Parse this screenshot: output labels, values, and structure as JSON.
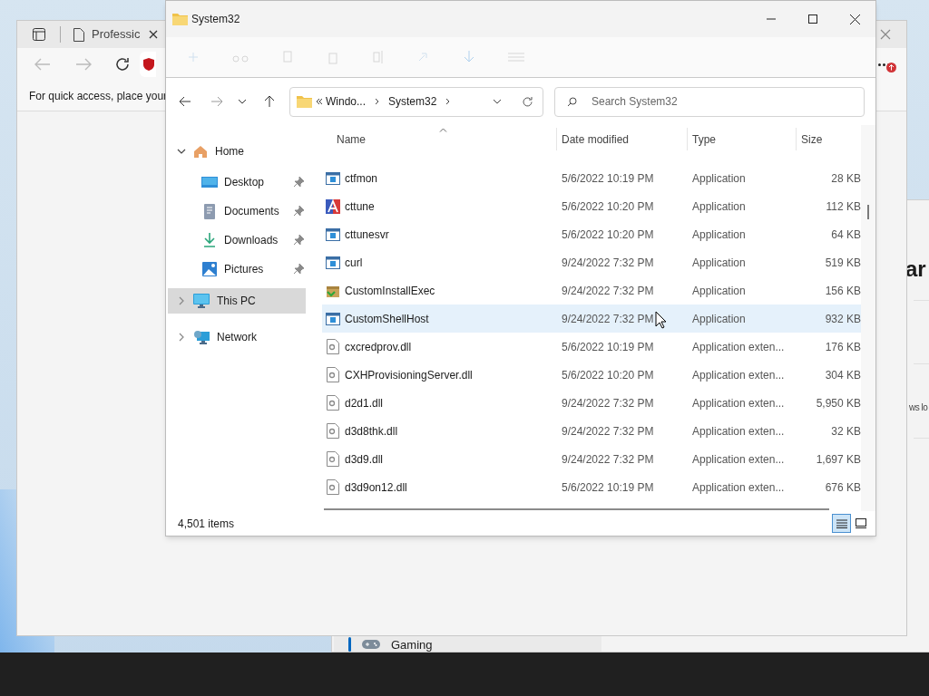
{
  "browser": {
    "tab": {
      "title": "Professic"
    },
    "favorites_hint": "For quick access, place your"
  },
  "settings_window": {
    "heading_fragment": "ar",
    "text_fragment": "ws lo",
    "nav_item": {
      "label": "Gaming",
      "selected": true
    }
  },
  "explorer": {
    "title": "System32",
    "breadcrumb": [
      "Windo...",
      "System32"
    ],
    "search_placeholder": "Search System32",
    "sidebar": [
      {
        "label": "Home",
        "kind": "home",
        "expanded": true,
        "selected": false,
        "children": [
          {
            "label": "Desktop",
            "kind": "desktop",
            "pinned": true,
            "selected": false
          },
          {
            "label": "Documents",
            "kind": "documents",
            "pinned": true,
            "selected": false
          },
          {
            "label": "Downloads",
            "kind": "downloads",
            "pinned": true,
            "selected": false
          },
          {
            "label": "Pictures",
            "kind": "pictures",
            "pinned": true,
            "selected": false
          }
        ]
      },
      {
        "label": "This PC",
        "kind": "computer",
        "expanded": false,
        "selected": true
      },
      {
        "label": "Network",
        "kind": "network",
        "expanded": false,
        "selected": false
      }
    ],
    "columns": [
      "Name",
      "Date modified",
      "Type",
      "Size"
    ],
    "rows": [
      {
        "name": "ctfmon",
        "date": "5/6/2022 10:19 PM",
        "type": "Application",
        "size": "28 KB",
        "kind": "program",
        "selected": false
      },
      {
        "name": "cttune",
        "date": "5/6/2022 10:20 PM",
        "type": "Application",
        "size": "112 KB",
        "kind": "lettered",
        "selected": false
      },
      {
        "name": "cttunesvr",
        "date": "5/6/2022 10:20 PM",
        "type": "Application",
        "size": "64 KB",
        "kind": "program",
        "selected": false
      },
      {
        "name": "curl",
        "date": "9/24/2022 7:32 PM",
        "type": "Application",
        "size": "519 KB",
        "kind": "program",
        "selected": false
      },
      {
        "name": "CustomInstallExec",
        "date": "9/24/2022 7:32 PM",
        "type": "Application",
        "size": "156 KB",
        "kind": "package",
        "selected": false
      },
      {
        "name": "CustomShellHost",
        "date": "9/24/2022 7:32 PM",
        "type": "Application",
        "size": "932 KB",
        "kind": "program",
        "selected": true
      },
      {
        "name": "cxcredprov.dll",
        "date": "5/6/2022 10:19 PM",
        "type": "Application exten...",
        "size": "176 KB",
        "kind": "library",
        "selected": false
      },
      {
        "name": "CXHProvisioningServer.dll",
        "date": "5/6/2022 10:20 PM",
        "type": "Application exten...",
        "size": "304 KB",
        "kind": "library",
        "selected": false
      },
      {
        "name": "d2d1.dll",
        "date": "9/24/2022 7:32 PM",
        "type": "Application exten...",
        "size": "5,950 KB",
        "kind": "library",
        "selected": false
      },
      {
        "name": "d3d8thk.dll",
        "date": "9/24/2022 7:32 PM",
        "type": "Application exten...",
        "size": "32 KB",
        "kind": "library",
        "selected": false
      },
      {
        "name": "d3d9.dll",
        "date": "9/24/2022 7:32 PM",
        "type": "Application exten...",
        "size": "1,697 KB",
        "kind": "library",
        "selected": false
      },
      {
        "name": "d3d9on12.dll",
        "date": "5/6/2022 10:19 PM",
        "type": "Application exten...",
        "size": "676 KB",
        "kind": "library",
        "selected": false
      }
    ],
    "status": "4,501 items",
    "views": [
      {
        "kind": "details",
        "selected": true
      },
      {
        "kind": "tiles",
        "selected": false
      }
    ]
  }
}
